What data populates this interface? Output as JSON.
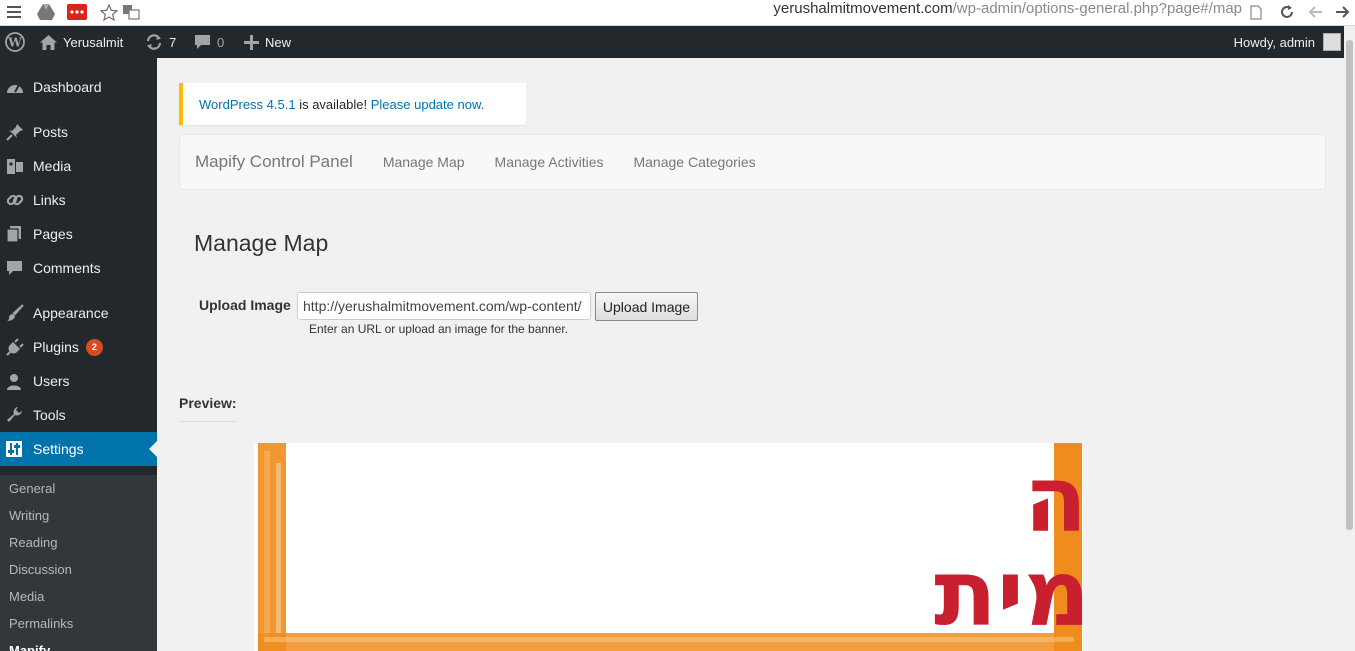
{
  "browser": {
    "url_host": "yerushalmitmovement.com",
    "url_path": "/wp-admin/options-general.php?page#/map"
  },
  "adminbar": {
    "site_name": "Yerusalmit",
    "updates_count": "7",
    "comments_count": "0",
    "new_label": "New",
    "howdy": "Howdy, admin"
  },
  "sidebar": {
    "items": [
      {
        "label": "Dashboard",
        "icon": "dashboard-icon"
      },
      {
        "label": "Posts",
        "icon": "pin-icon"
      },
      {
        "label": "Media",
        "icon": "media-icon"
      },
      {
        "label": "Links",
        "icon": "link-icon"
      },
      {
        "label": "Pages",
        "icon": "pages-icon"
      },
      {
        "label": "Comments",
        "icon": "comment-icon"
      },
      {
        "label": "Appearance",
        "icon": "brush-icon"
      },
      {
        "label": "Plugins",
        "icon": "plug-icon",
        "badge": "2"
      },
      {
        "label": "Users",
        "icon": "users-icon"
      },
      {
        "label": "Tools",
        "icon": "wrench-icon"
      },
      {
        "label": "Settings",
        "icon": "settings-icon"
      }
    ],
    "submenu": [
      "General",
      "Writing",
      "Reading",
      "Discussion",
      "Media",
      "Permalinks",
      "Mapify"
    ]
  },
  "notice": {
    "version_link": "WordPress 4.5.1",
    "middle": " is available! ",
    "update_link": "Please update now."
  },
  "navbar": {
    "brand": "Mapify Control Panel",
    "links": [
      "Manage Map",
      "Manage Activities",
      "Manage Categories"
    ]
  },
  "main": {
    "heading": "Manage Map",
    "upload_label": "Upload Image",
    "url_value": "http://yerushalmitmovement.com/wp-content/",
    "upload_button": "Upload Image",
    "help_text": "Enter an URL or upload an image for the banner.",
    "preview_label": "Preview:",
    "banner_line1": "התנועה",
    "banner_line2": "הירושלמית"
  },
  "colors": {
    "admin_bg": "#23282d",
    "accent": "#0073aa",
    "notice_border": "#ffb900",
    "badge": "#d54e21",
    "banner_red": "#c8202f",
    "banner_orange": "#f08c1e"
  }
}
